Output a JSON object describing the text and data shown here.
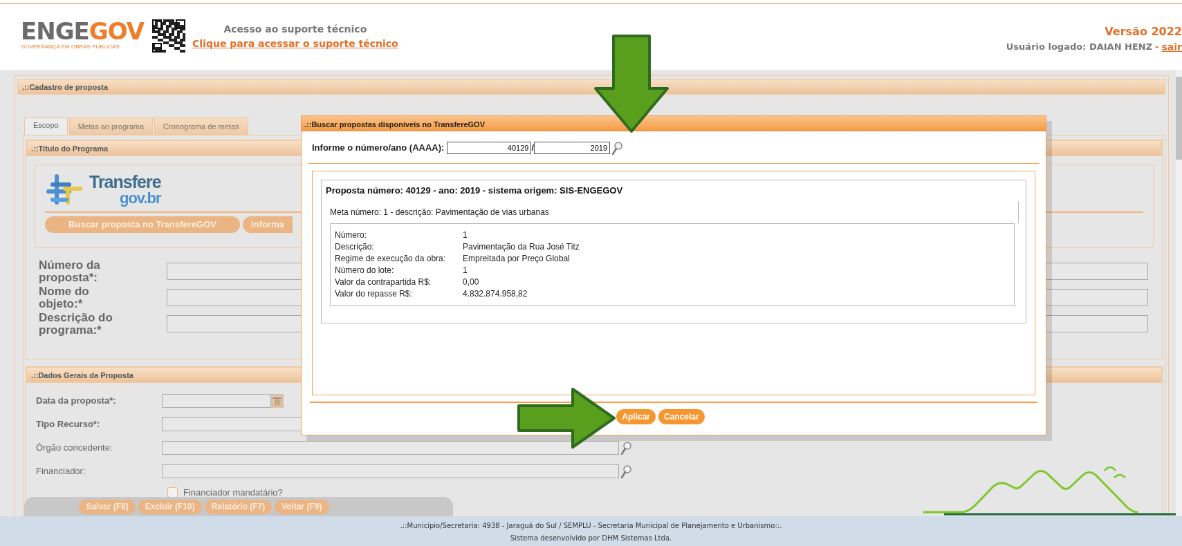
{
  "header": {
    "logo": [
      "ENGE",
      "GOV"
    ],
    "tagline": "GOVERNANÇA EM OBRAS PÚBLICAS",
    "support_title": "Acesso ao suporte técnico",
    "support_link": "Clique para acessar o suporte técnico",
    "version": "Versão 2022",
    "user_label": "Usuário logado: DAIAN HENZ",
    "separator": "-",
    "logout": "sair"
  },
  "panel_title": ".::Cadastro de proposta",
  "tabs": [
    {
      "label": "Escopo",
      "selected": true
    },
    {
      "label": "Metas ao programa",
      "selected": false
    },
    {
      "label": "Cronograma de metas",
      "selected": false
    }
  ],
  "program_section": {
    "title": ".::Título do Programa",
    "logo": [
      "Transfere",
      "gov.br"
    ],
    "buttons": [
      "Buscar proposta no TransfereGOV",
      "Informa"
    ],
    "fields": [
      {
        "label": "Número da proposta*:"
      },
      {
        "label": "Nome do objeto:*"
      },
      {
        "label": "Descrição do programa:*"
      }
    ]
  },
  "general_section": {
    "title": ".::Dados Gerais da Proposta",
    "fields": [
      {
        "label": "Data da proposta*:",
        "kind": "date",
        "required": true
      },
      {
        "label": "Tipo Recurso*:",
        "kind": "text",
        "required": true
      },
      {
        "label": "Órgão concedente:",
        "kind": "lookup",
        "required": false
      },
      {
        "label": "Financiador:",
        "kind": "lookup",
        "required": false
      }
    ],
    "checkbox": {
      "label": "Financiador mandatário?",
      "checked": false
    }
  },
  "actions": [
    "Salvar (F8)",
    "Excluir (F10)",
    "Relatório (F7)",
    "Voltar (F9)"
  ],
  "footer": {
    "line1": ".::Município/Secretaria: 4938 - Jaraguá do Sul / SEMPLU - Secretaria Municipal de Planejamento e Urbanismo::.",
    "line2": "Sistema desenvolvido por DHM Sistemas Ltda."
  },
  "modal": {
    "title": ".::Buscar propostas disponíveis no TransfereGOV",
    "query_label": "Informe o número/ano (AAAA):",
    "number": "40129",
    "year_separator": "/",
    "year": "2019",
    "result_title": "Proposta número: 40129 - ano: 2019 - sistema origem: SIS-ENGEGOV",
    "goal_line": "Meta número: 1 - descrição: Pavimentação de vias urbanas",
    "details": [
      {
        "label": "Número:",
        "value": "1"
      },
      {
        "label": "Descrição:",
        "value": "Pavimentação da Rua José Titz"
      },
      {
        "label": "Regime de execução da obra:",
        "value": "Empreitada por Preço Global"
      },
      {
        "label": "Número do lote:",
        "value": "1"
      },
      {
        "label": "Valor da contrapartida R$:",
        "value": "0,00"
      },
      {
        "label": "Valor do repasse R$:",
        "value": "4.832.874.958,82"
      }
    ],
    "buttons": [
      "Aplicar",
      "Cancelar"
    ]
  }
}
